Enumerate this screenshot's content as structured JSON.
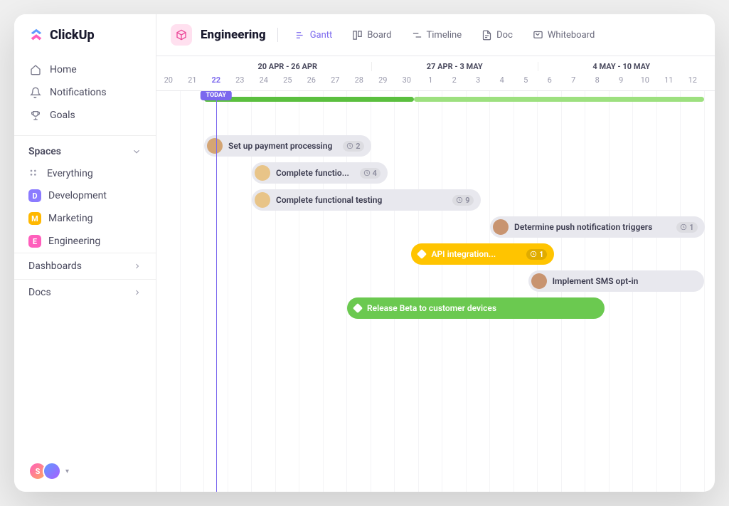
{
  "brand": "ClickUp",
  "nav": [
    {
      "label": "Home",
      "icon": "home"
    },
    {
      "label": "Notifications",
      "icon": "bell"
    },
    {
      "label": "Goals",
      "icon": "trophy"
    }
  ],
  "spaces": {
    "label": "Spaces",
    "everything": "Everything",
    "items": [
      {
        "key": "D",
        "label": "Development",
        "color": "#8b7bff"
      },
      {
        "key": "M",
        "label": "Marketing",
        "color": "#ffb800"
      },
      {
        "key": "E",
        "label": "Engineering",
        "color": "#ff5ebc"
      }
    ]
  },
  "sections": [
    {
      "label": "Dashboards"
    },
    {
      "label": "Docs"
    }
  ],
  "workspace_avatars": [
    "S",
    ""
  ],
  "header": {
    "space": "Engineering",
    "views": [
      {
        "label": "Gantt",
        "icon": "gantt",
        "active": true
      },
      {
        "label": "Board",
        "icon": "board"
      },
      {
        "label": "Timeline",
        "icon": "timeline"
      },
      {
        "label": "Doc",
        "icon": "doc"
      },
      {
        "label": "Whiteboard",
        "icon": "whiteboard"
      }
    ]
  },
  "timeline": {
    "today_label": "TODAY",
    "today_index": 2,
    "ranges": [
      {
        "label": "20 APR - 26 APR",
        "span": 7,
        "offset": 2
      },
      {
        "label": "27 APR - 3 MAY",
        "span": 7,
        "offset": 9
      },
      {
        "label": "4 MAY - 10 MAY",
        "span": 7,
        "offset": 16
      }
    ],
    "days": [
      "20",
      "21",
      "22",
      "23",
      "24",
      "25",
      "26",
      "27",
      "28",
      "29",
      "30",
      "1",
      "2",
      "3",
      "4",
      "5",
      "6",
      "7",
      "8",
      "9",
      "10",
      "11",
      "12"
    ],
    "progress": [
      {
        "start": 2,
        "end": 10.8,
        "color": "#5bbf3f"
      },
      {
        "start": 10.8,
        "end": 23,
        "color": "#9de07f"
      }
    ]
  },
  "tasks": [
    {
      "row": 0,
      "start": 2,
      "end": 9,
      "style": "grey",
      "avatar": "a",
      "label": "Set up payment processing",
      "count": "2"
    },
    {
      "row": 1,
      "start": 4,
      "end": 9.7,
      "style": "grey",
      "avatar": "b",
      "label": "Complete functio...",
      "count": "4"
    },
    {
      "row": 2,
      "start": 4,
      "end": 13.6,
      "style": "grey",
      "avatar": "b",
      "label": "Complete functional testing",
      "count": "9"
    },
    {
      "row": 3,
      "start": 14,
      "end": 23,
      "style": "grey",
      "avatar": "c",
      "label": "Determine push notification triggers",
      "count": "1"
    },
    {
      "row": 4,
      "start": 10.7,
      "end": 16.7,
      "style": "yellow",
      "diamond": true,
      "label": "API integration...",
      "count": "1"
    },
    {
      "row": 5,
      "start": 15.6,
      "end": 23,
      "style": "grey",
      "avatar": "c",
      "label": "Implement SMS opt-in"
    },
    {
      "row": 6,
      "start": 8,
      "end": 18.8,
      "style": "green",
      "diamond": true,
      "label": "Release Beta to customer devices"
    }
  ]
}
